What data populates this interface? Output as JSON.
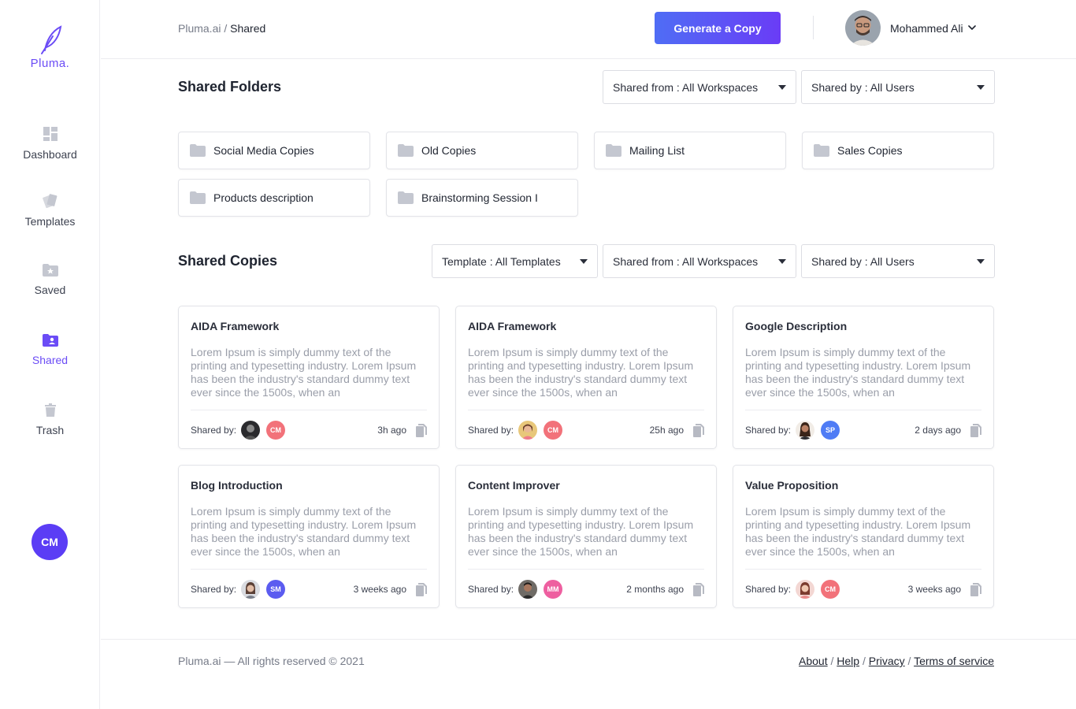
{
  "brand": {
    "name": "Pluma.",
    "accent": "#6b4cf6"
  },
  "sidebar": {
    "items": [
      {
        "label": "Dashboard",
        "icon": "dashboard-icon"
      },
      {
        "label": "Templates",
        "icon": "templates-icon"
      },
      {
        "label": "Saved",
        "icon": "saved-folder-icon"
      },
      {
        "label": "Shared",
        "icon": "shared-folder-icon",
        "active": true
      },
      {
        "label": "Trash",
        "icon": "trash-icon"
      }
    ],
    "avatar_initials": "CM"
  },
  "header": {
    "breadcrumb_root": "Pluma.ai",
    "breadcrumb_sep": " / ",
    "breadcrumb_current": "Shared",
    "generate_label": "Generate a Copy",
    "user_name": "Mohammed Ali"
  },
  "folders_section": {
    "title": "Shared Folders",
    "filters": {
      "shared_from": "Shared from : All Workspaces",
      "shared_by": "Shared by : All Users"
    },
    "folders": [
      "Social Media Copies",
      "Old Copies",
      "Mailing List",
      "Sales Copies",
      "Products description",
      "Brainstorming Session I"
    ]
  },
  "copies_section": {
    "title": "Shared Copies",
    "filters": {
      "template": "Template : All Templates",
      "shared_from": "Shared from : All Workspaces",
      "shared_by": "Shared by : All Users"
    },
    "shared_by_label": "Shared by:",
    "cards": [
      {
        "title": "AIDA Framework",
        "text": "Lorem Ipsum is simply dummy text of the printing and typesetting industry. Lorem Ipsum has been the industry's standard dummy text ever since the 1500s, when an",
        "initials": "CM",
        "badge_color": "#f2727a",
        "time": "3h ago"
      },
      {
        "title": "AIDA Framework",
        "text": "Lorem Ipsum is simply dummy text of the printing and typesetting industry. Lorem Ipsum has been the industry's standard dummy text ever since the 1500s, when an",
        "initials": "CM",
        "badge_color": "#f2727a",
        "time": "25h ago"
      },
      {
        "title": "Google Description",
        "text": "Lorem Ipsum is simply dummy text of the printing and typesetting industry. Lorem Ipsum has been the industry's standard dummy text ever since the 1500s, when an",
        "initials": "SP",
        "badge_color": "#4f7cf5",
        "time": "2 days ago"
      },
      {
        "title": "Blog Introduction",
        "text": "Lorem Ipsum is simply dummy text of the printing and typesetting industry. Lorem Ipsum has been the industry's standard dummy text ever since the 1500s, when an",
        "initials": "SM",
        "badge_color": "#5b5cf0",
        "time": "3 weeks ago"
      },
      {
        "title": "Content Improver",
        "text": "Lorem Ipsum is simply dummy text of the printing and typesetting industry. Lorem Ipsum has been the industry's standard dummy text ever since the 1500s, when an",
        "initials": "MM",
        "badge_color": "#ee5fa0",
        "time": "2 months ago"
      },
      {
        "title": "Value Proposition",
        "text": "Lorem Ipsum is simply dummy text of the printing and typesetting industry. Lorem Ipsum has been the industry's standard dummy text ever since the 1500s, when an",
        "initials": "CM",
        "badge_color": "#f2727a",
        "time": "3 weeks ago"
      }
    ]
  },
  "footer": {
    "copyright": "Pluma.ai — All rights reserved © 2021",
    "links": [
      "About",
      "Help",
      "Privacy",
      "Terms of service"
    ],
    "link_sep": " / "
  }
}
